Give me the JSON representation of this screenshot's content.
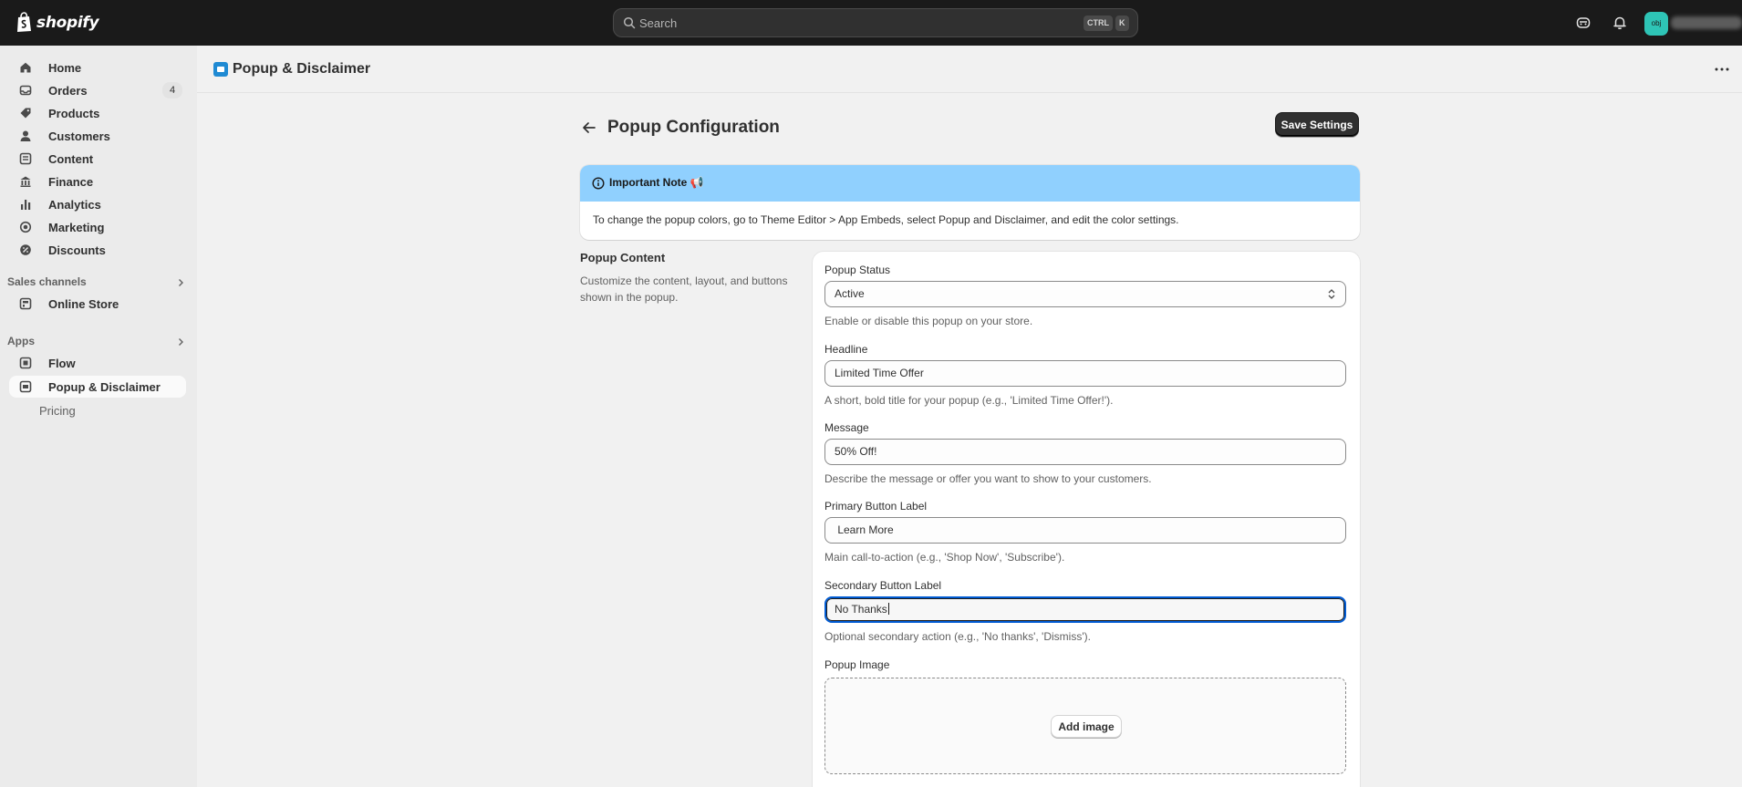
{
  "topbar": {
    "brand": "shopify",
    "search_placeholder": "Search",
    "shortcut_ctrl": "CTRL",
    "shortcut_key": "K",
    "avatar_initials": "obj"
  },
  "sidebar": {
    "items": [
      {
        "label": "Home",
        "icon": "home-icon"
      },
      {
        "label": "Orders",
        "icon": "inbox-icon",
        "badge": "4"
      },
      {
        "label": "Products",
        "icon": "tag-icon"
      },
      {
        "label": "Customers",
        "icon": "person-icon"
      },
      {
        "label": "Content",
        "icon": "content-icon"
      },
      {
        "label": "Finance",
        "icon": "bank-icon"
      },
      {
        "label": "Analytics",
        "icon": "bar-chart-icon"
      },
      {
        "label": "Marketing",
        "icon": "target-icon"
      },
      {
        "label": "Discounts",
        "icon": "discount-icon"
      }
    ],
    "sales_channels_title": "Sales channels",
    "online_store": "Online Store",
    "apps_title": "Apps",
    "flow": "Flow",
    "popup_app": "Popup & Disclaimer",
    "pricing": "Pricing"
  },
  "app_header": {
    "title": "Popup & Disclaimer"
  },
  "page": {
    "title": "Popup Configuration",
    "save_label": "Save Settings"
  },
  "note": {
    "title": "Important Note 📢",
    "body": "To change the popup colors, go to Theme Editor > App Embeds, select Popup and Disclaimer, and edit the color settings."
  },
  "section": {
    "title": "Popup Content",
    "description": "Customize the content, layout, and buttons shown in the popup."
  },
  "form": {
    "status": {
      "label": "Popup Status",
      "value": "Active",
      "help": "Enable or disable this popup on your store."
    },
    "headline": {
      "label": "Headline",
      "value": "Limited Time Offer",
      "help": "A short, bold title for your popup (e.g., 'Limited Time Offer!')."
    },
    "message": {
      "label": "Message",
      "value": "50% Off!",
      "help": "Describe the message or offer you want to show to your customers."
    },
    "primary": {
      "label": "Primary Button Label",
      "value": " Learn More",
      "help": "Main call-to-action (e.g., 'Shop Now', 'Subscribe')."
    },
    "secondary": {
      "label": "Secondary Button Label",
      "value": "No Thanks",
      "help": "Optional secondary action (e.g., 'No thanks', 'Dismiss')."
    },
    "image": {
      "label": "Popup Image",
      "button": "Add image"
    }
  }
}
